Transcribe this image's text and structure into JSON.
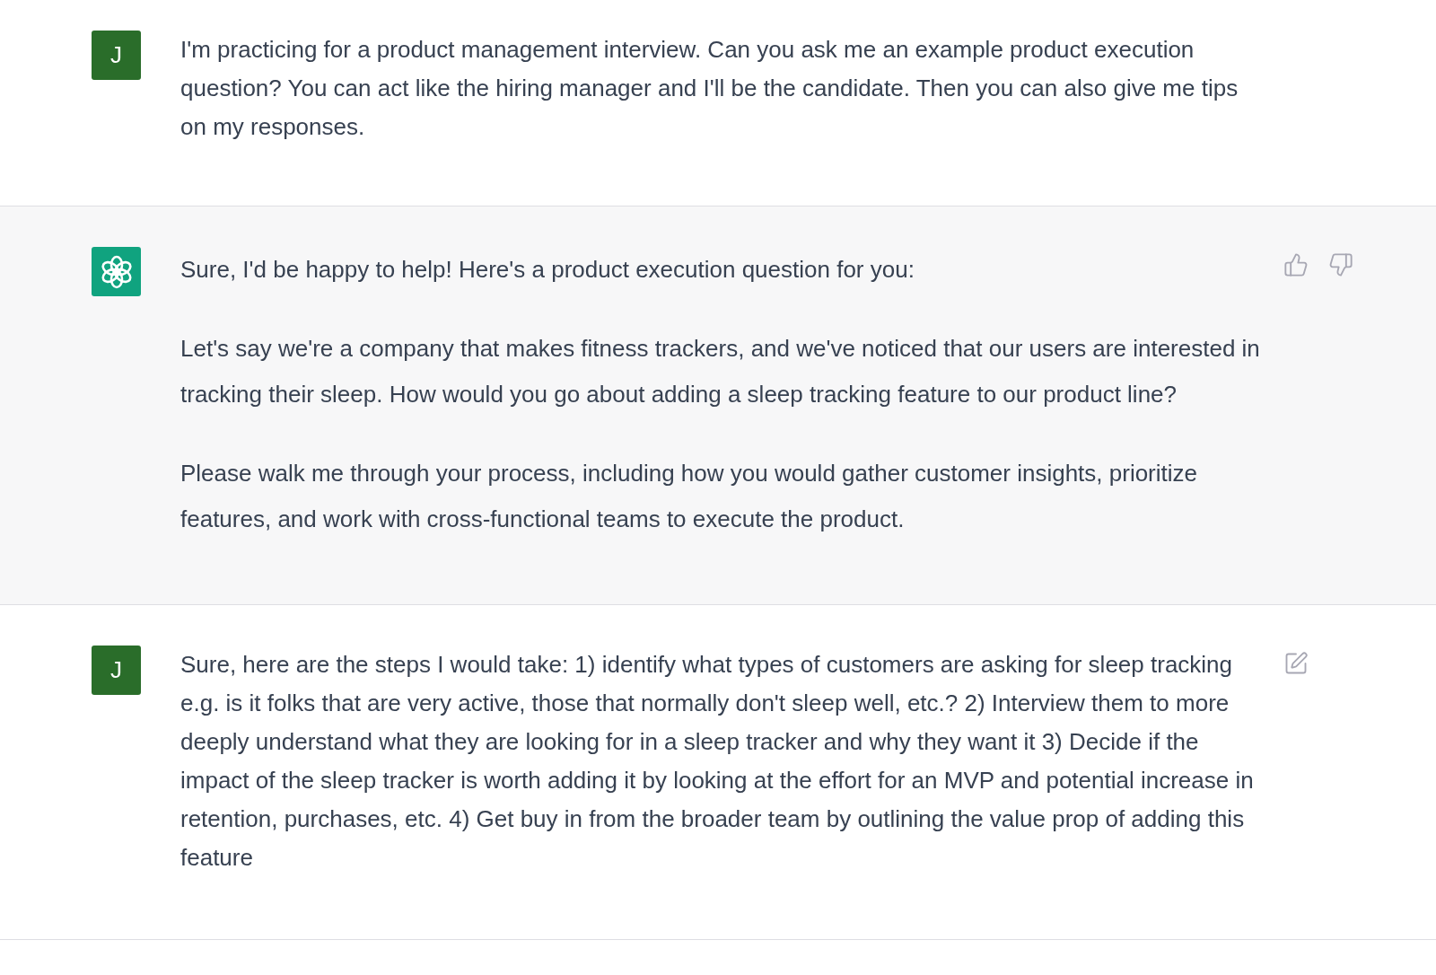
{
  "messages": [
    {
      "kind": "user",
      "avatar": "J",
      "paragraphs": [
        "I'm practicing for a product management interview. Can you ask me an example product execution question? You can act like the hiring manager and I'll be the candidate. Then you can also give me tips on my responses."
      ]
    },
    {
      "kind": "assistant",
      "paragraphs": [
        "Sure, I'd be happy to help! Here's a product execution question for you:",
        "Let's say we're a company that makes fitness trackers, and we've noticed that our users are interested in tracking their sleep. How would you go about adding a sleep tracking feature to our product line?",
        "Please walk me through your process, including how you would gather customer insights, prioritize features, and work with cross-functional teams to execute the product."
      ]
    },
    {
      "kind": "user",
      "avatar": "J",
      "paragraphs": [
        "Sure, here are the steps I would take: 1) identify what types of customers are asking for sleep tracking e.g. is it folks that are very active, those that normally don't sleep well, etc.? 2) Interview them to more deeply understand what they are looking for in a sleep tracker and why they want it 3) Decide if the impact of the sleep tracker is worth adding it by looking at the effort for an MVP and potential increase in retention, purchases, etc. 4) Get buy in from the broader team by outlining the value prop of adding this feature"
      ]
    }
  ]
}
